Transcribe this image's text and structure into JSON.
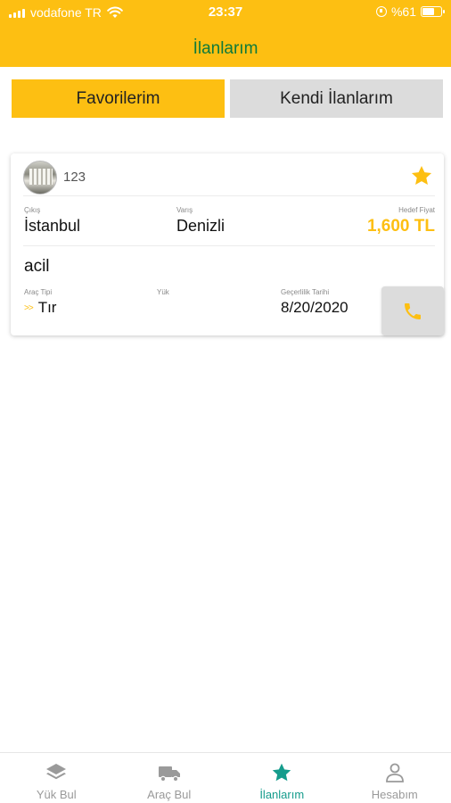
{
  "status_bar": {
    "carrier": "vodafone TR",
    "time": "23:37",
    "battery": "%61"
  },
  "header": {
    "title": "İlanlarım",
    "accent_color": "#FDBF12",
    "title_color": "#0f7a3a"
  },
  "tabs": [
    {
      "label": "Favorilerim",
      "active": true
    },
    {
      "label": "Kendi İlanlarım",
      "active": false
    }
  ],
  "listing": {
    "id": "123",
    "favorite": true,
    "origin_label": "Çıkış",
    "origin": "İstanbul",
    "destination_label": "Varış",
    "destination": "Denizli",
    "price_label": "Hedef Fiyat",
    "price": "1,600 TL",
    "note": "acil",
    "vehicle_label": "Araç Tipi",
    "vehicle": "Tır",
    "load_label": "Yük",
    "load": "",
    "validity_label": "Geçerlilik Tarihi",
    "validity": "8/20/2020"
  },
  "bottom_nav": {
    "items": [
      {
        "label": "Yük Bul",
        "icon": "layers-icon",
        "active": false
      },
      {
        "label": "Araç Bul",
        "icon": "truck-icon",
        "active": false
      },
      {
        "label": "İlanlarım",
        "icon": "star-icon",
        "active": true
      },
      {
        "label": "Hesabım",
        "icon": "user-icon",
        "active": false
      }
    ],
    "active_color": "#159c8c"
  }
}
